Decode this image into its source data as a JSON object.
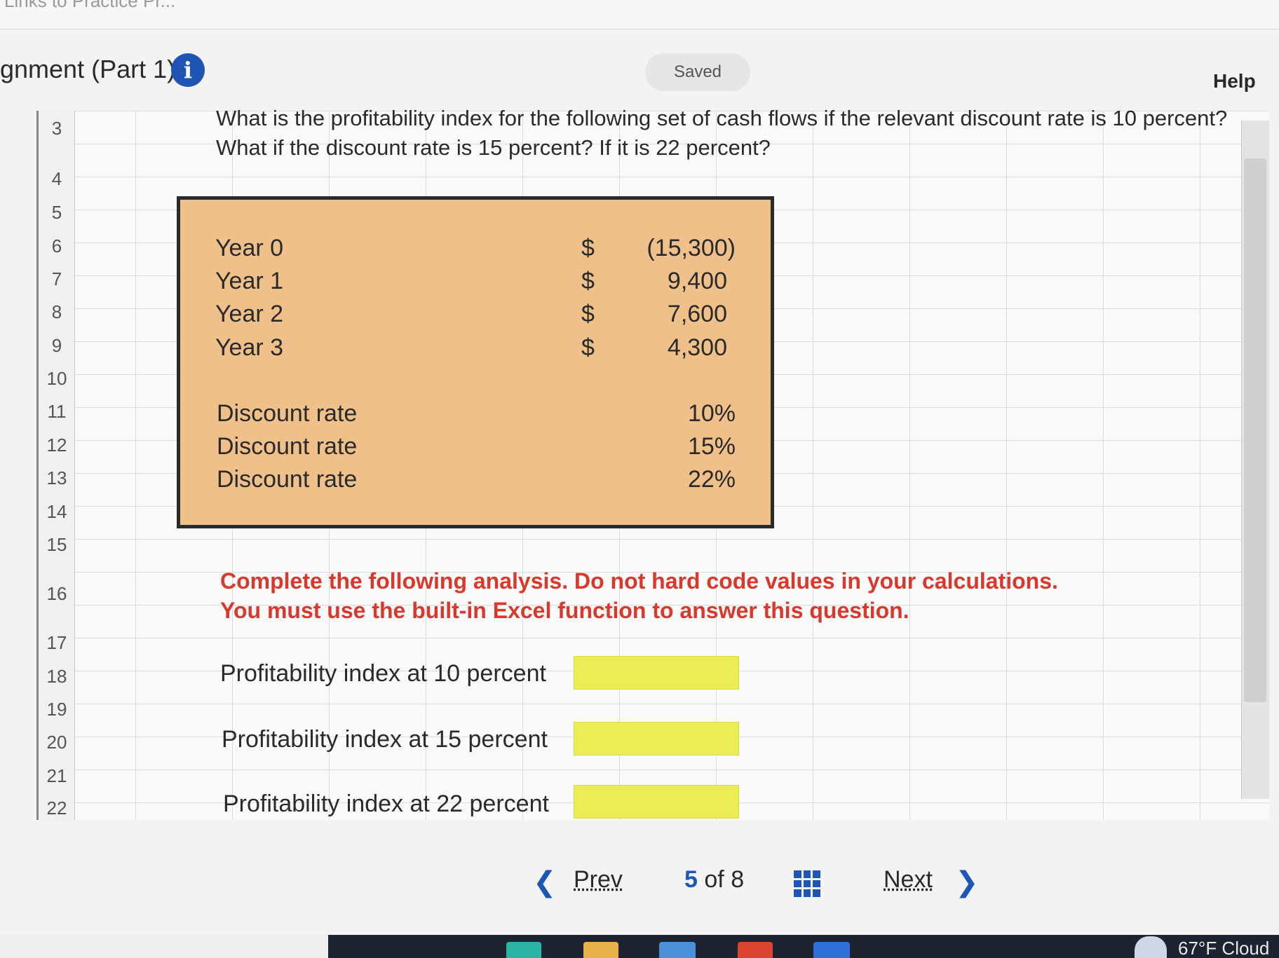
{
  "browser": {
    "crumb": "Links to Practice Pr..."
  },
  "header": {
    "title": "gnment (Part 1)",
    "info_icon": "info-icon",
    "saved": "Saved",
    "help": "Help"
  },
  "sheet": {
    "row_numbers": [
      "3",
      "4",
      "5",
      "6",
      "7",
      "8",
      "9",
      "10",
      "11",
      "12",
      "13",
      "14",
      "15",
      "16",
      "17",
      "18",
      "19",
      "20",
      "21",
      "22"
    ],
    "question": "What is the profitability index for the following set of cash flows if the relevant discount rate is 10 percent? What if the discount rate is 15 percent? If it is 22 percent?",
    "cash_flows": [
      {
        "label": "Year 0",
        "symbol": "$",
        "value": "(15,300)"
      },
      {
        "label": "Year 1",
        "symbol": "$",
        "value": "9,400"
      },
      {
        "label": "Year 2",
        "symbol": "$",
        "value": "7,600"
      },
      {
        "label": "Year 3",
        "symbol": "$",
        "value": "4,300"
      }
    ],
    "discount_rates": [
      {
        "label": "Discount rate",
        "value": "10%"
      },
      {
        "label": "Discount rate",
        "value": "15%"
      },
      {
        "label": "Discount rate",
        "value": "22%"
      }
    ],
    "instruction_line1": "Complete the following analysis. Do not hard code values in your calculations.",
    "instruction_line2": "You must use the built-in Excel function to answer this question.",
    "answers": [
      {
        "label": "Profitability index at 10 percent",
        "value": ""
      },
      {
        "label": "Profitability index at 15 percent",
        "value": ""
      },
      {
        "label": "Profitability index at 22 percent",
        "value": ""
      }
    ],
    "colors": {
      "data_box": "#f0c08a",
      "input_cell": "#ecec55",
      "instruction": "#d9382c"
    }
  },
  "pager": {
    "prev": "Prev",
    "current": "5",
    "of": "of",
    "total": "8",
    "next": "Next",
    "prev_icon": "chevron-left-icon",
    "next_icon": "chevron-right-icon",
    "grid_icon": "grid-icon"
  },
  "taskbar": {
    "weather": "67°F  Cloud"
  }
}
